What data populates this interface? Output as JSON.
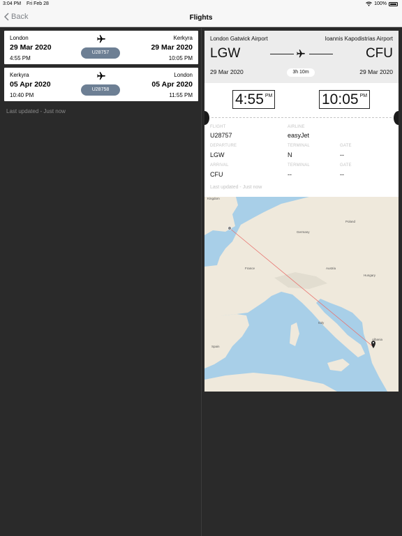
{
  "status": {
    "time": "3:04 PM",
    "date": "Fri Feb 28",
    "battery": "100%"
  },
  "nav": {
    "back_label": "Back",
    "title": "Flights"
  },
  "flights": [
    {
      "origin_city": "London",
      "dest_city": "Kerkyra",
      "dep_date": "29 Mar 2020",
      "arr_date": "29 Mar 2020",
      "dep_time": "4:55 PM",
      "arr_time": "10:05 PM",
      "flight_no": "U28757"
    },
    {
      "origin_city": "Kerkyra",
      "dest_city": "London",
      "dep_date": "05 Apr 2020",
      "arr_date": "05 Apr 2020",
      "dep_time": "10:40 PM",
      "arr_time": "11:55 PM",
      "flight_no": "U28758"
    }
  ],
  "list_last_updated": "Last updated - Just now",
  "detail": {
    "origin_airport": "London Gatwick Airport",
    "dest_airport": "Ioannis Kapodistrias Airport",
    "origin_code": "LGW",
    "dest_code": "CFU",
    "dep_date": "29 Mar 2020",
    "arr_date": "29 Mar 2020",
    "duration": "3h 10m",
    "dep_time": "4:55",
    "dep_ampm": "PM",
    "arr_time": "10:05",
    "arr_ampm": "PM",
    "labels": {
      "flight": "FLIGHT",
      "airline": "AIRLINE",
      "departure": "DEPARTURE",
      "terminal": "TERMINAL",
      "gate": "GATE",
      "arrival": "ARRIVAL"
    },
    "flight_no": "U28757",
    "airline": "easyJet",
    "departure_airport": "LGW",
    "departure_terminal": "N",
    "departure_gate": "--",
    "arrival_airport": "CFU",
    "arrival_terminal": "--",
    "arrival_gate": "--",
    "last_updated": "Last updated - Just now"
  },
  "map": {
    "labels": {
      "kingdom": "Kingdom",
      "germany": "Germany",
      "poland": "Poland",
      "france": "France",
      "austria": "Austria",
      "hungary": "Hungary",
      "italy": "Italy",
      "spain": "Spain",
      "albania": "Albania"
    },
    "route_color": "#e8736f"
  },
  "colors": {
    "badge": "#6d7f94",
    "back": "#7f8388"
  }
}
